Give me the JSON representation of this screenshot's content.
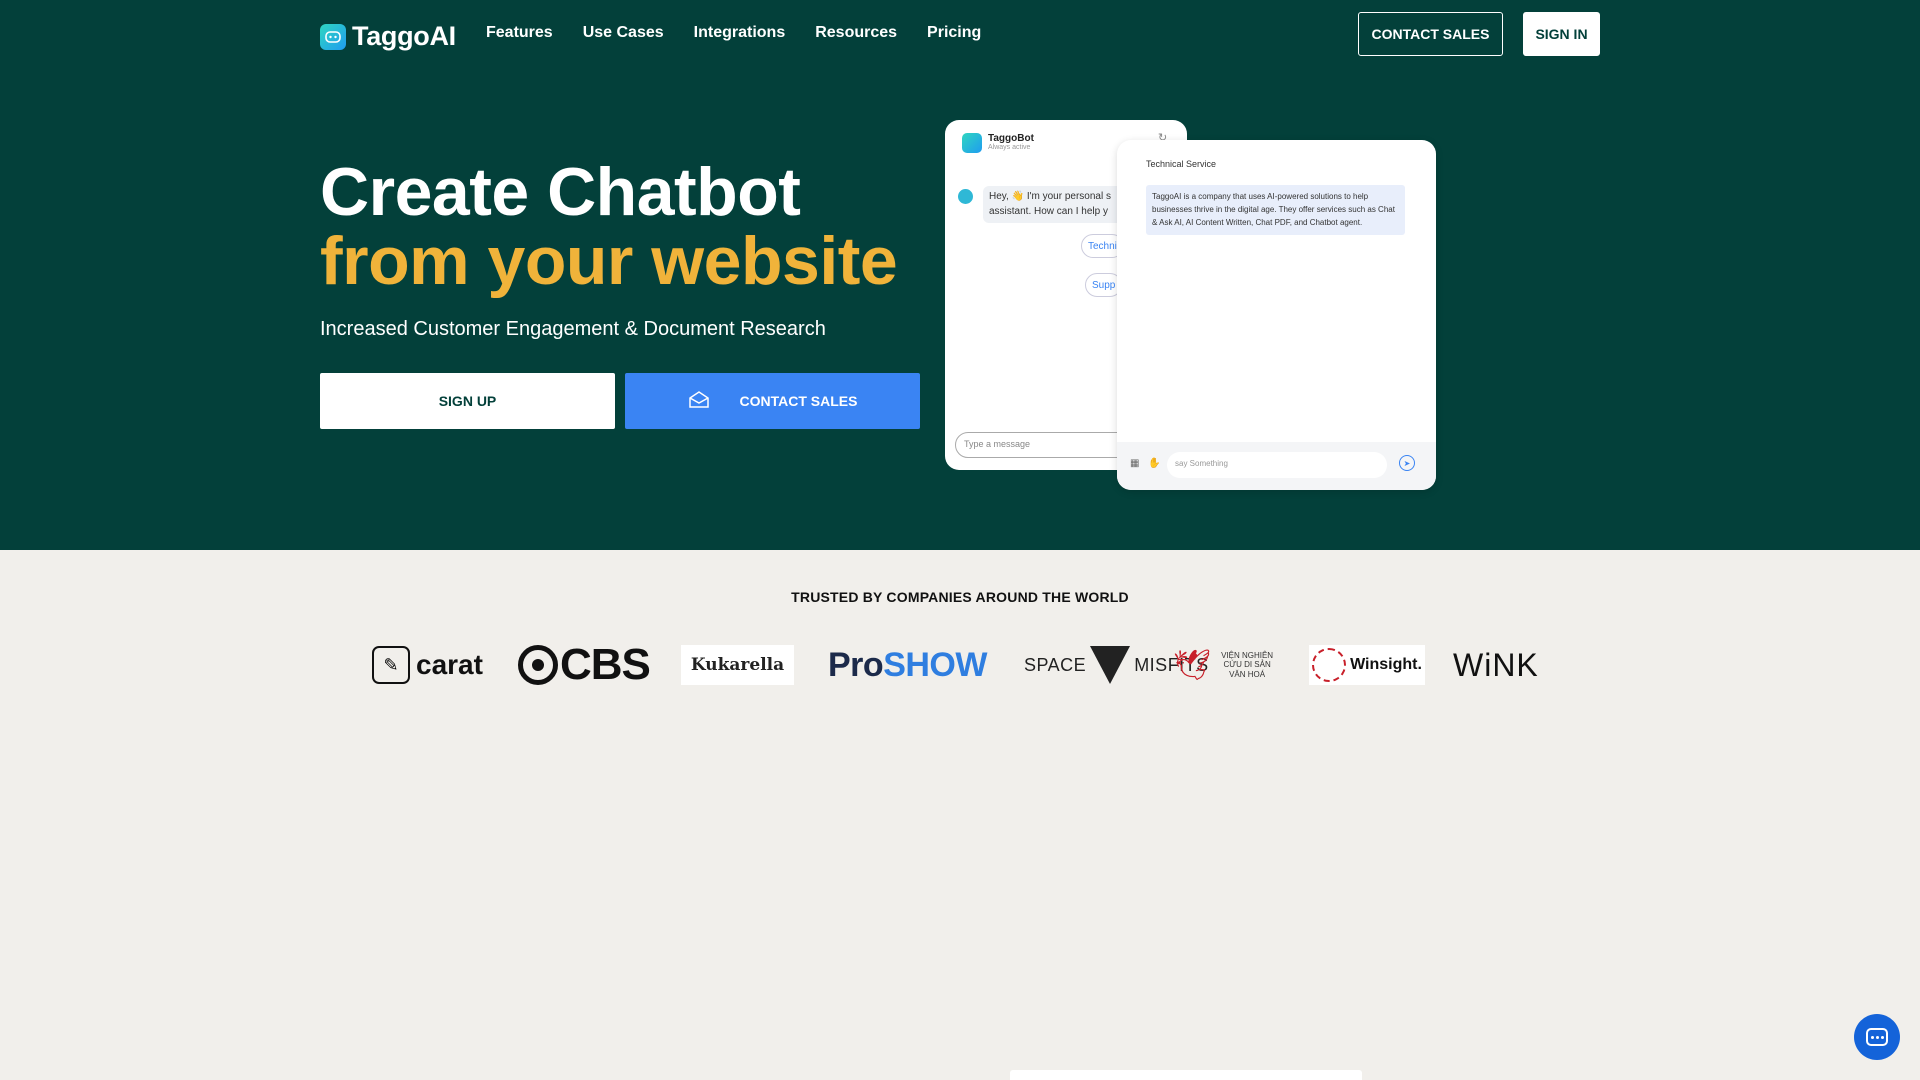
{
  "nav": {
    "brand": "TaggoAI",
    "menu": [
      "Features",
      "Use Cases",
      "Integrations",
      "Resources",
      "Pricing"
    ],
    "contact_sales": "CONTACT SALES",
    "sign_in": "SIGN IN"
  },
  "hero": {
    "title_line1": "Create Chatbot",
    "title_line2": "from your website",
    "subtitle": "Increased Customer Engagement & Document Research",
    "signup_label": "SIGN UP",
    "contact_label": "CONTACT SALES",
    "colors": {
      "background": "#03403a",
      "accent": "#f0b33a",
      "button_blue": "#3a84f3"
    }
  },
  "chat_left": {
    "bot_name": "TaggoBot",
    "bot_status": "Always active",
    "greeting": "Hey, 👋 I'm your personal s assistant. How can I help y",
    "chips": [
      "Techni",
      "Supp"
    ],
    "input_placeholder": "Type a message"
  },
  "chat_right": {
    "title": "Technical Service",
    "message": "TaggoAI is a company that uses AI-powered solutions to help businesses thrive in the digital age. They offer services such as Chat & Ask AI, AI Content Written, Chat PDF, and Chatbot agent.",
    "input_placeholder": "say Something"
  },
  "trusted": {
    "heading": "TRUSTED BY COMPANIES AROUND THE WORLD",
    "logos": {
      "carat": "carat",
      "cbs": "CBS",
      "kukarella": "Kukarella",
      "proshow_a": "Pro",
      "proshow_b": "SHOW",
      "space_a": "SPACE",
      "space_b": "MISFITS",
      "vien": "VIỆN NGHIÊN CỨU DI SẢN VĂN HOÁ",
      "winsight": "Winsight.",
      "wink": "WiNK"
    }
  },
  "icons": {
    "logo": "robot-chat-icon",
    "contact_cta": "envelope-icon",
    "fab": "chat-bubble-icon"
  }
}
